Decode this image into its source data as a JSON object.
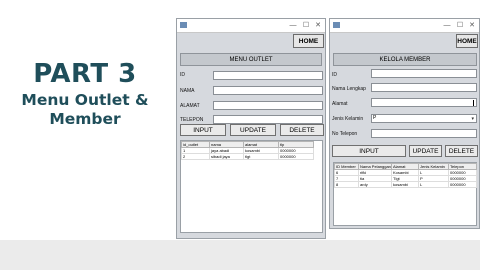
{
  "title": {
    "line1": "PART 3",
    "line2": "Menu Outlet &",
    "line3": "Member"
  },
  "outlet_window": {
    "controls": {
      "minimize": "—",
      "maximize": "☐",
      "close": "✕"
    },
    "home_label": "HOME",
    "header": "MENU OUTLET",
    "fields": [
      {
        "label": "ID",
        "value": ""
      },
      {
        "label": "NAMA",
        "value": ""
      },
      {
        "label": "ALAMAT",
        "value": ""
      },
      {
        "label": "TELEPON",
        "value": ""
      }
    ],
    "buttons": {
      "input": "INPUT",
      "update": "UPDATE",
      "delete": "DELETE"
    },
    "table": {
      "columns": [
        "id_outlet",
        "nama",
        "alamat",
        "tlp"
      ],
      "rows": [
        [
          "1",
          "jaya abadi",
          "kosambi",
          "0000000"
        ],
        [
          "2",
          "sibadi jaya",
          "tlgt",
          "0000000"
        ]
      ]
    }
  },
  "member_window": {
    "controls": {
      "minimize": "—",
      "maximize": "☐",
      "close": "✕"
    },
    "home_label": "HOME",
    "header": "KELOLA MEMBER",
    "fields": [
      {
        "label": "ID",
        "value": ""
      },
      {
        "label": "Nama Lengkap",
        "value": ""
      },
      {
        "label": "Alamat",
        "value": ""
      },
      {
        "label": "Jenis Kelamin",
        "value": "P"
      },
      {
        "label": "No Telepon",
        "value": ""
      }
    ],
    "buttons": {
      "input": "INPUT",
      "update": "UPDATE",
      "delete": "DELETE"
    },
    "table": {
      "columns": [
        "ID Member",
        "Nama Pelanggan",
        "Alamat",
        "Jenis Kelamin",
        "Telepon"
      ],
      "rows": [
        [
          "6",
          "rifki",
          "Kosambi",
          "L",
          "0000000"
        ],
        [
          "7",
          "tia",
          "Tlgt",
          "P",
          "0000000"
        ],
        [
          "8",
          "ardy",
          "kosambi",
          "L",
          "0000000"
        ]
      ]
    }
  }
}
